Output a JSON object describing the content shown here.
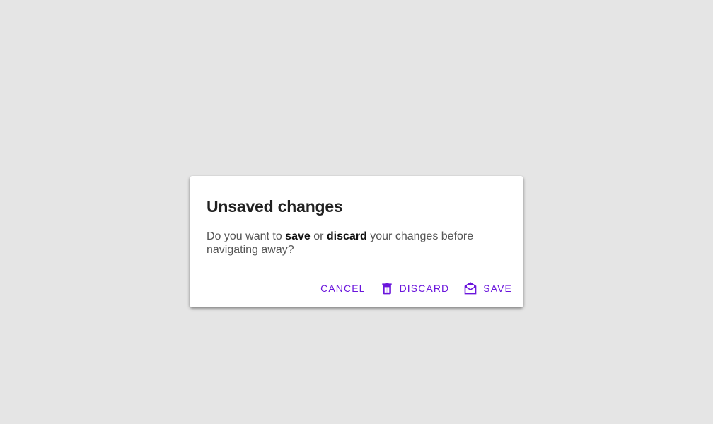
{
  "dialog": {
    "title": "Unsaved changes",
    "message": {
      "part1": "Do you want to ",
      "save_word": "save",
      "part2": " or ",
      "discard_word": "discard",
      "part3": " your changes before navigating away?"
    },
    "actions": {
      "cancel_label": "CANCEL",
      "discard_label": "DISCARD",
      "save_label": "SAVE"
    }
  },
  "icons": {
    "discard": "trash-icon",
    "save": "open-envelope-icon"
  },
  "colors": {
    "accent": "#6b16dc",
    "backdrop": "#e5e5e5",
    "surface": "#ffffff",
    "title": "#212121",
    "body_text": "#555555"
  }
}
